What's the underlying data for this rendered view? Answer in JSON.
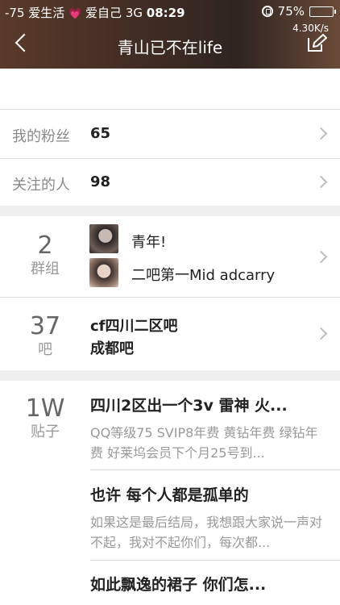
{
  "status_bar": {
    "signal": "-75",
    "carrier": "爱生活",
    "heart": "💗",
    "carrier2": "爱自己",
    "network": "3G",
    "time": "08:29",
    "battery": "75%",
    "battery_level": 0.75
  },
  "header": {
    "net_speed": "4.30K/s",
    "title": "青山已不在life"
  },
  "stats": {
    "fans_label": "我的粉丝",
    "fans_value": "65",
    "following_label": "关注的人",
    "following_value": "98"
  },
  "groups": {
    "count": "2",
    "unit": "群组",
    "items": [
      "青年!",
      "二吧第一Mid adcarry"
    ]
  },
  "bars": {
    "count": "37",
    "unit": "吧",
    "items": [
      "cf四川二区吧",
      "成都吧"
    ]
  },
  "posts": {
    "count": "1W",
    "unit": "贴子",
    "items": [
      {
        "title": "四川2区出一个3v 雷神 火...",
        "body": "QQ等级75 SVIP8年费 黄钻年费 绿钻年费 好莱坞会员下个月25号到..."
      },
      {
        "title": "也许 每个人都是孤单的",
        "body": "如果这是最后结局，我想跟大家说一声对不起，我对不起你们，每次都..."
      },
      {
        "title": "如此飘逸的裙子  你们怎...",
        "body": ""
      }
    ]
  },
  "colors": {
    "header": "#3e2b23",
    "background": "#efefef"
  }
}
